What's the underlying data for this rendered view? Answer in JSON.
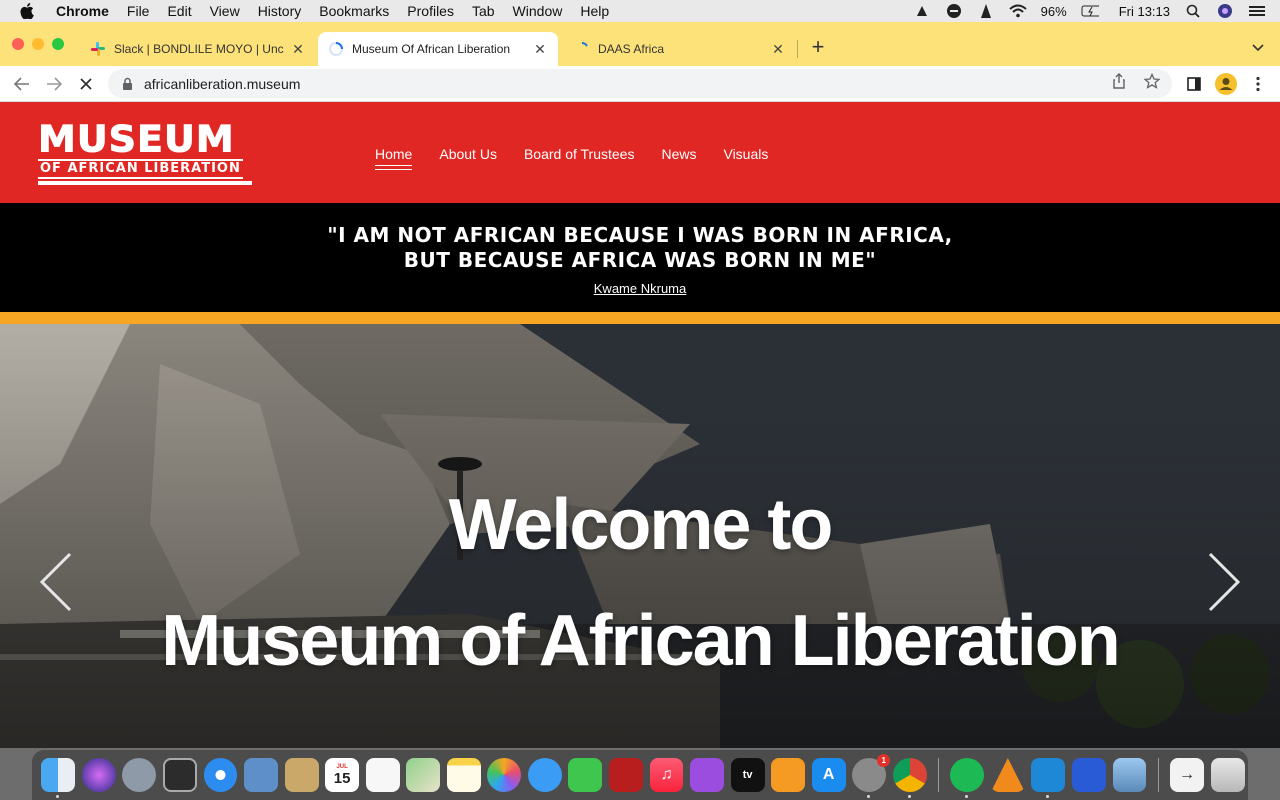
{
  "menubar": {
    "app_name": "Chrome",
    "items": [
      "File",
      "Edit",
      "View",
      "History",
      "Bookmarks",
      "Profiles",
      "Tab",
      "Window",
      "Help"
    ],
    "battery": "96%",
    "clock": "Fri 13:13"
  },
  "tabs": [
    {
      "title": "Slack | BONDLILE MOYO | Unc",
      "icon": "slack-icon",
      "active": false
    },
    {
      "title": "Museum Of African Liberation",
      "icon": "loading-spinner-icon",
      "active": true
    },
    {
      "title": "DAAS Africa",
      "icon": "loading-spinner-icon",
      "active": false
    }
  ],
  "toolbar": {
    "url": "africanliberation.museum"
  },
  "site": {
    "logo": {
      "line1": "MUSEUM",
      "line2": "OF AFRICAN LIBERATION"
    },
    "nav": [
      {
        "label": "Home",
        "active": true
      },
      {
        "label": "About Us"
      },
      {
        "label": "Board of Trustees"
      },
      {
        "label": "News"
      },
      {
        "label": "Visuals"
      }
    ],
    "quote": {
      "line1": "\"I am not African because I was born in Africa,",
      "line2": "but because Africa was born in me\"",
      "author": "Kwame Nkruma"
    },
    "hero": {
      "line1": "Welcome to",
      "line2": "Museum of African Liberation"
    },
    "colors": {
      "header_red": "#e02724",
      "accent_gold": "#f6a623",
      "quote_bg": "#000000"
    }
  },
  "dock": {
    "calendar_day": "15",
    "calendar_month": "JUL",
    "settings_badge": "1",
    "apps": [
      "finder-icon",
      "siri-icon",
      "launchpad-icon",
      "mission-control-icon",
      "safari-icon",
      "mail-icon",
      "contacts-icon",
      "calendar-icon",
      "reminders-icon",
      "maps-icon",
      "notes-icon",
      "photos-icon",
      "messages-icon",
      "facetime-icon",
      "photo-booth-icon",
      "music-icon",
      "podcasts-icon",
      "tv-icon",
      "books-icon",
      "app-store-icon",
      "system-preferences-icon",
      "chrome-icon",
      "spotify-icon",
      "vlc-icon",
      "vscode-icon",
      "cyberduck-icon",
      "preview-icon",
      "downloads-stack-icon",
      "trash-icon"
    ]
  }
}
